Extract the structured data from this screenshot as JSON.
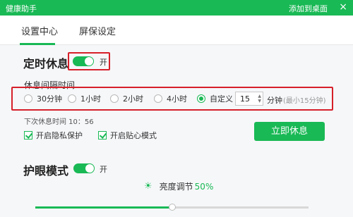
{
  "window": {
    "title": "健康助手",
    "add_to_desktop": "添加到桌面",
    "close": "×"
  },
  "tabs": [
    {
      "label": "设置中心",
      "active": true
    },
    {
      "label": "屏保设定",
      "active": false
    }
  ],
  "timed_rest": {
    "title": "定时休息",
    "toggle_on": true,
    "toggle_text": "开",
    "interval_label": "休息间隔时间",
    "options": [
      {
        "label": "30分钟",
        "selected": false
      },
      {
        "label": "1小时",
        "selected": false
      },
      {
        "label": "2小时",
        "selected": false
      },
      {
        "label": "4小时",
        "selected": false
      },
      {
        "label": "自定义",
        "selected": true
      }
    ],
    "custom_value": "15",
    "unit": "分钟",
    "hint": "(最小15分钟)",
    "next_time": "下次休息时间 10：56",
    "checkboxes": [
      {
        "label": "开启隐私保护",
        "checked": true
      },
      {
        "label": "开启贴心模式",
        "checked": true
      }
    ],
    "rest_now_button": "立即休息"
  },
  "eye_protection": {
    "title": "护眼模式",
    "toggle_on": true,
    "toggle_text": "开",
    "brightness_label": "亮度调节",
    "brightness_value": "50%",
    "brightness_level": 0.5
  },
  "colors": {
    "accent": "#19b955",
    "highlight_box": "#d6202a"
  }
}
